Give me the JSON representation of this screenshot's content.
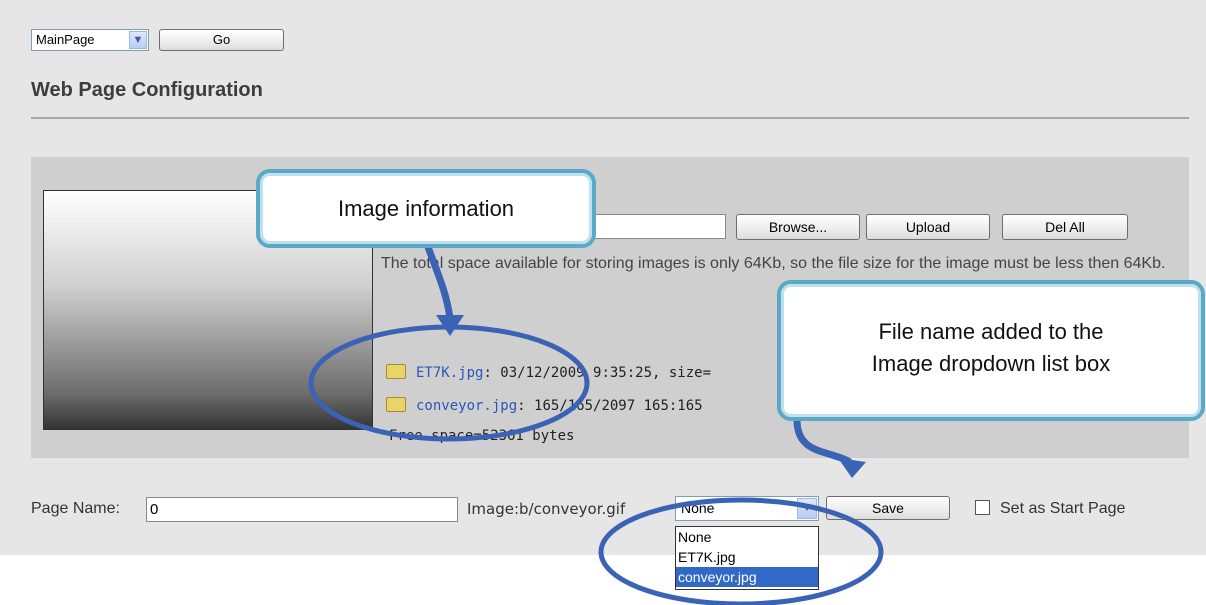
{
  "nav": {
    "page_select_value": "MainPage",
    "go_label": "Go"
  },
  "page_title": "Web Page Configuration",
  "upload": {
    "browse_label": "Browse...",
    "upload_label": "Upload",
    "del_all_label": "Del All",
    "info_text": "The total space available for storing images is only 64Kb, so the file size for the image must be less then 64Kb.",
    "files": [
      {
        "name": "ET7K.jpg",
        "details": ": 03/12/2009 9:35:25, size="
      },
      {
        "name": "conveyor.jpg",
        "details": ": 165/165/2097 165:165"
      }
    ],
    "free_space": "Free space=52361 bytes"
  },
  "form": {
    "page_name_label": "Page Name:",
    "page_name_value": "0",
    "image_label": "Image:b/conveyor.gif",
    "image_select_value": "None",
    "image_options": [
      "None",
      "ET7K.jpg",
      "conveyor.jpg"
    ],
    "image_selected_index": 2,
    "save_label": "Save",
    "start_page_label": "Set as Start Page"
  },
  "callouts": {
    "image_info": "Image information",
    "file_added_line1": "File name added to the",
    "file_added_line2": "Image dropdown list box"
  },
  "colors": {
    "callout_border": "#5aa9c6",
    "annotation_blue": "#3a62b5",
    "highlight": "#3169c6"
  }
}
